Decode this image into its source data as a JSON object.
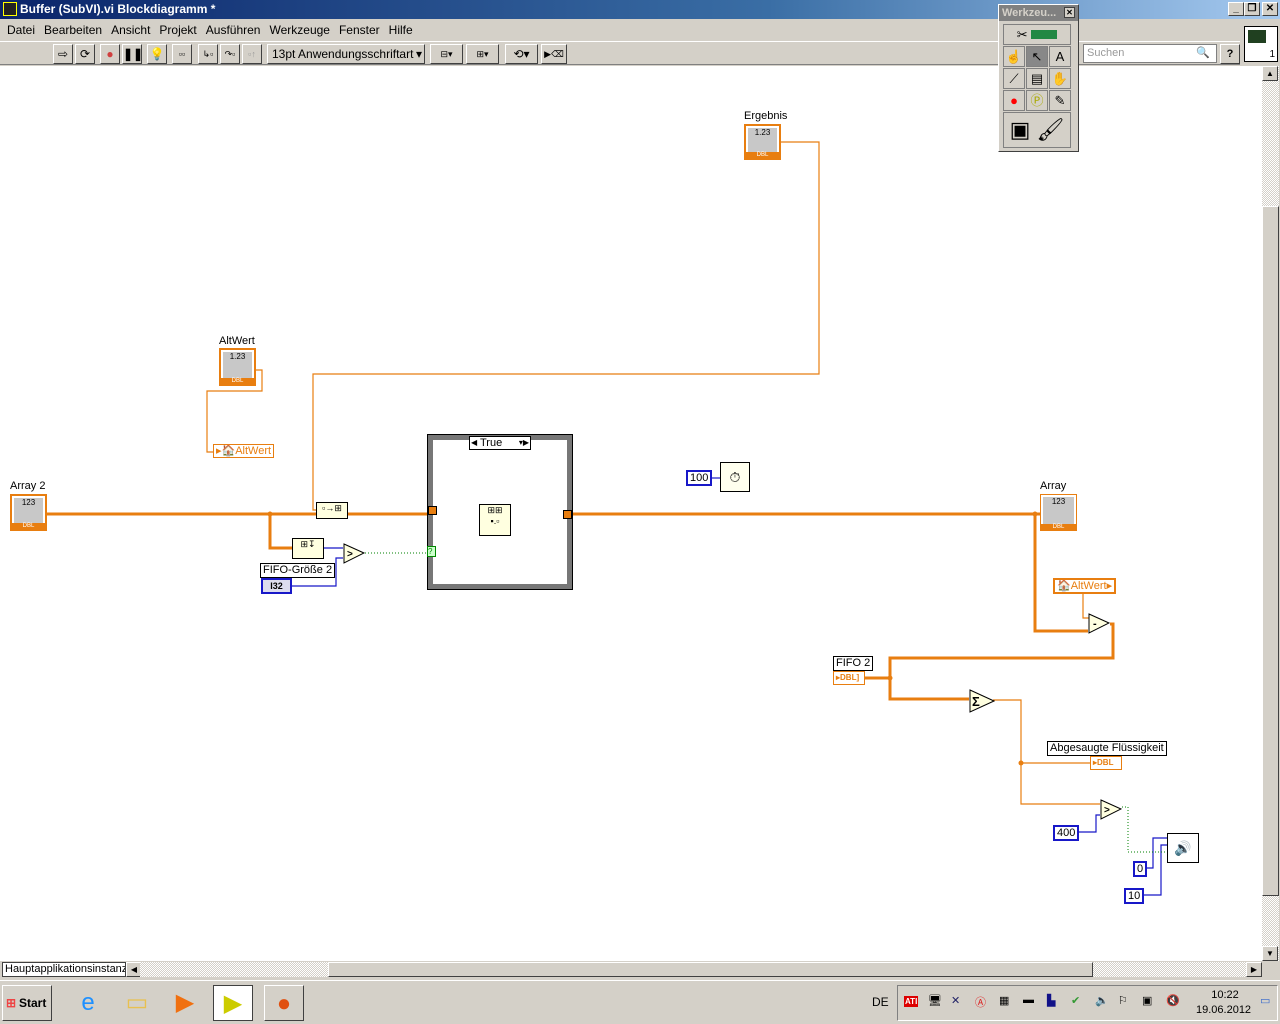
{
  "window": {
    "title": "Buffer (SubVI).vi Blockdiagramm *"
  },
  "menu": [
    "Datei",
    "Bearbeiten",
    "Ansicht",
    "Projekt",
    "Ausführen",
    "Werkzeuge",
    "Fenster",
    "Hilfe"
  ],
  "toolbar": {
    "font": "13pt Anwendungsschriftart",
    "search_placeholder": "Suchen",
    "help": "?"
  },
  "tools_palette": {
    "title": "Werkzeu..."
  },
  "diagram": {
    "ergebnis": "Ergebnis",
    "altwert": "AltWert",
    "altwert_local": "AltWert",
    "array2": "Array 2",
    "array": "Array",
    "fifo_size": "FIFO-Größe 2",
    "fifo_size_type": "I32",
    "fifo2": "FIFO 2",
    "fifo2_type": "DBL",
    "abgesaugt": "Abgesaugte Flüssigkeit",
    "abgesaugt_type": "DBL",
    "case_selector": "True",
    "const_100": "100",
    "const_400": "400",
    "const_0": "0",
    "const_10": "10",
    "num_icon": "1.23",
    "arr_icon": "123",
    "dbl": "DBL"
  },
  "statusbar": {
    "context": "Hauptapplikationsinstanz"
  },
  "taskbar": {
    "start": "Start",
    "lang": "DE",
    "time": "10:22",
    "date": "19.06.2012"
  },
  "colors": {
    "wire_dbl": "#e87e10",
    "wire_int": "#1818c8",
    "wire_bool": "#008000"
  }
}
